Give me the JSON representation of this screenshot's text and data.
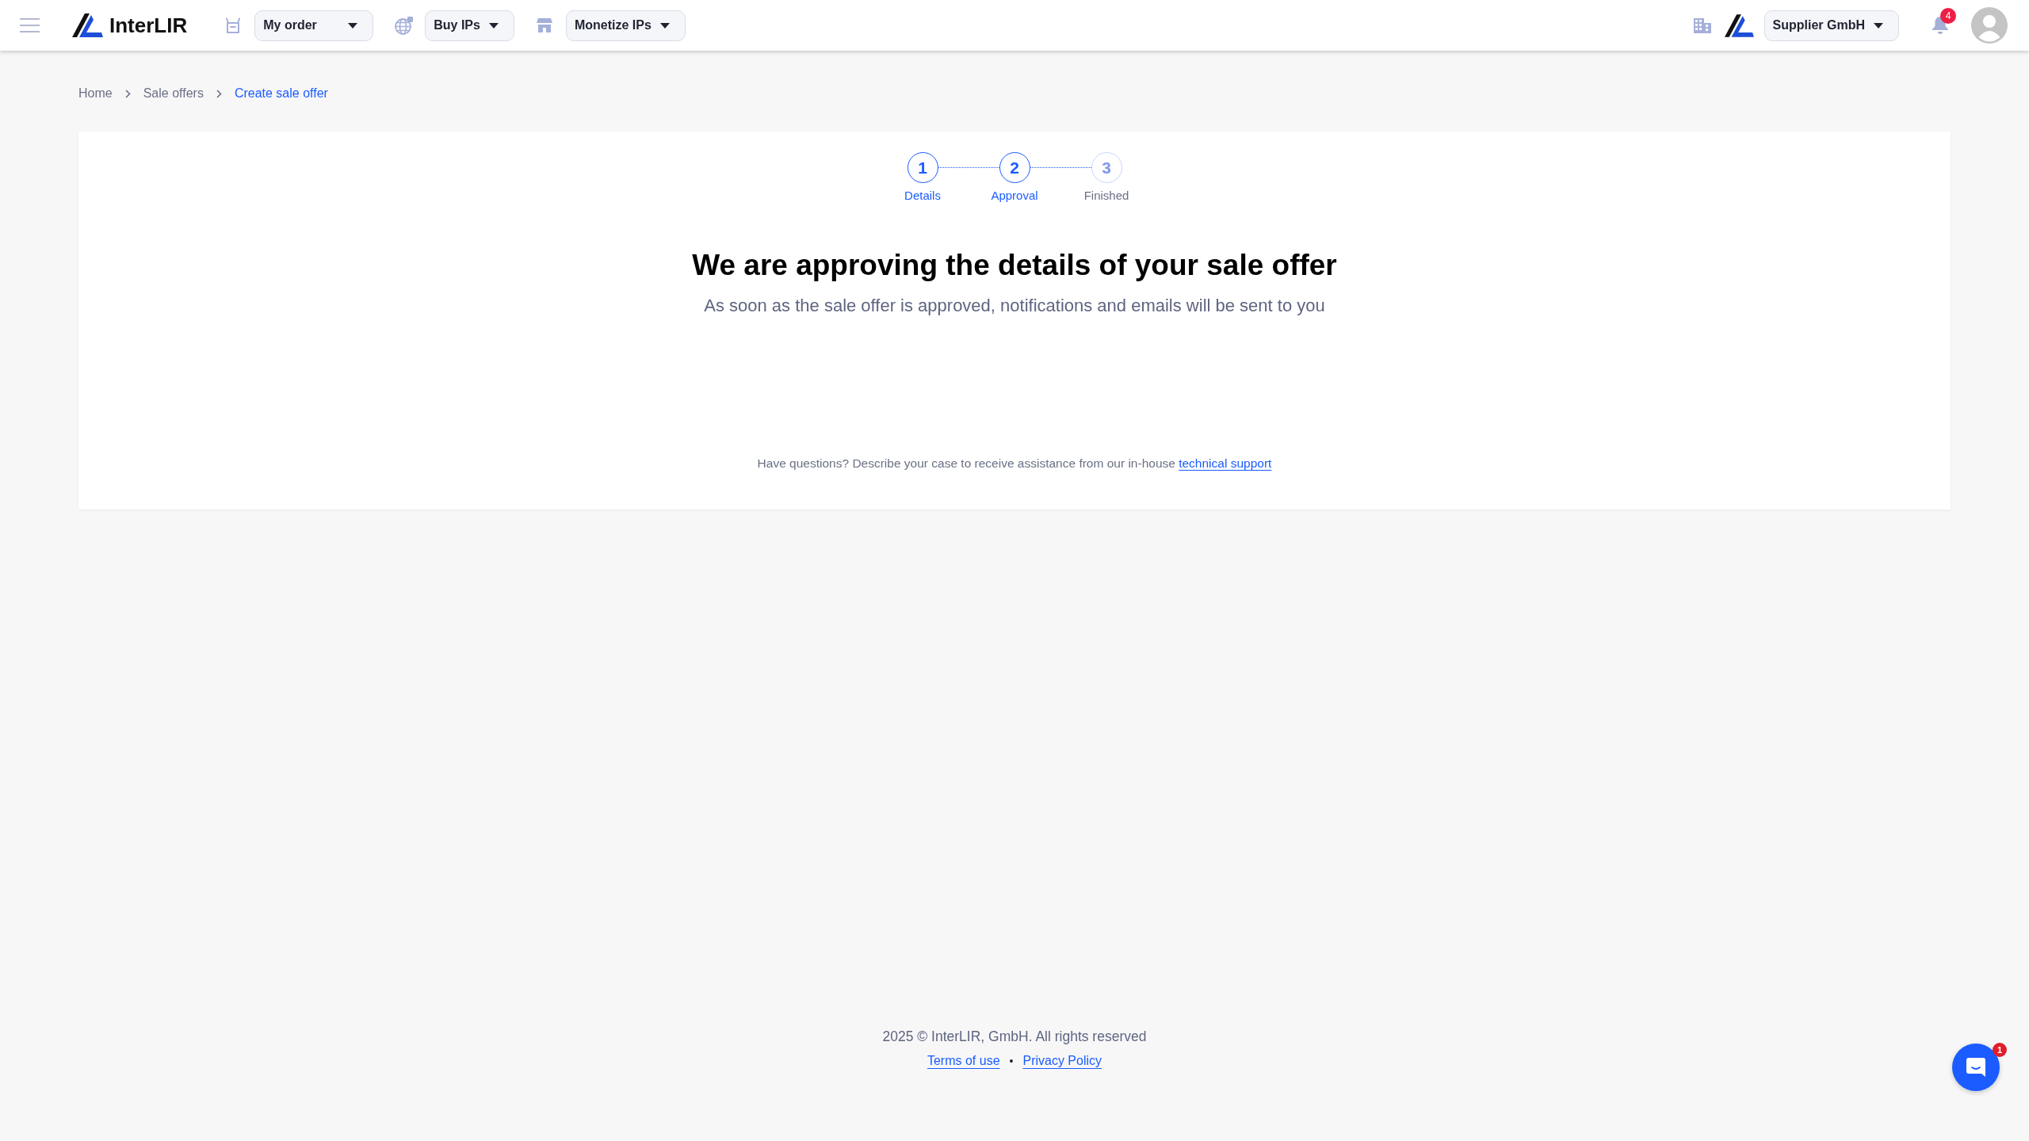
{
  "header": {
    "brand": "InterLIR",
    "nav": [
      {
        "label": "My order"
      },
      {
        "label": "Buy IPs"
      },
      {
        "label": "Monetize IPs"
      }
    ],
    "account": {
      "label": "Supplier GmbH"
    },
    "notifications": {
      "count": "4"
    }
  },
  "breadcrumb": [
    {
      "label": "Home",
      "current": false
    },
    {
      "label": "Sale offers",
      "current": false
    },
    {
      "label": "Create sale offer",
      "current": true
    }
  ],
  "stepper": [
    {
      "number": "1",
      "label": "Details",
      "reached": true
    },
    {
      "number": "2",
      "label": "Approval",
      "reached": true
    },
    {
      "number": "3",
      "label": "Finished",
      "reached": false
    }
  ],
  "heading": "We are approving the details of your sale offer",
  "subheading": "As soon as the sale offer is approved, notifications and emails will be sent to you",
  "help": {
    "text": "Have questions? Describe your case to receive assistance from our in-house",
    "link": "technical support"
  },
  "footer": {
    "copyright": "2025 © InterLIR, GmbH. All rights reserved",
    "links": [
      "Terms of use",
      "Privacy Policy"
    ],
    "separator": "•"
  },
  "chat": {
    "badge": "1"
  }
}
